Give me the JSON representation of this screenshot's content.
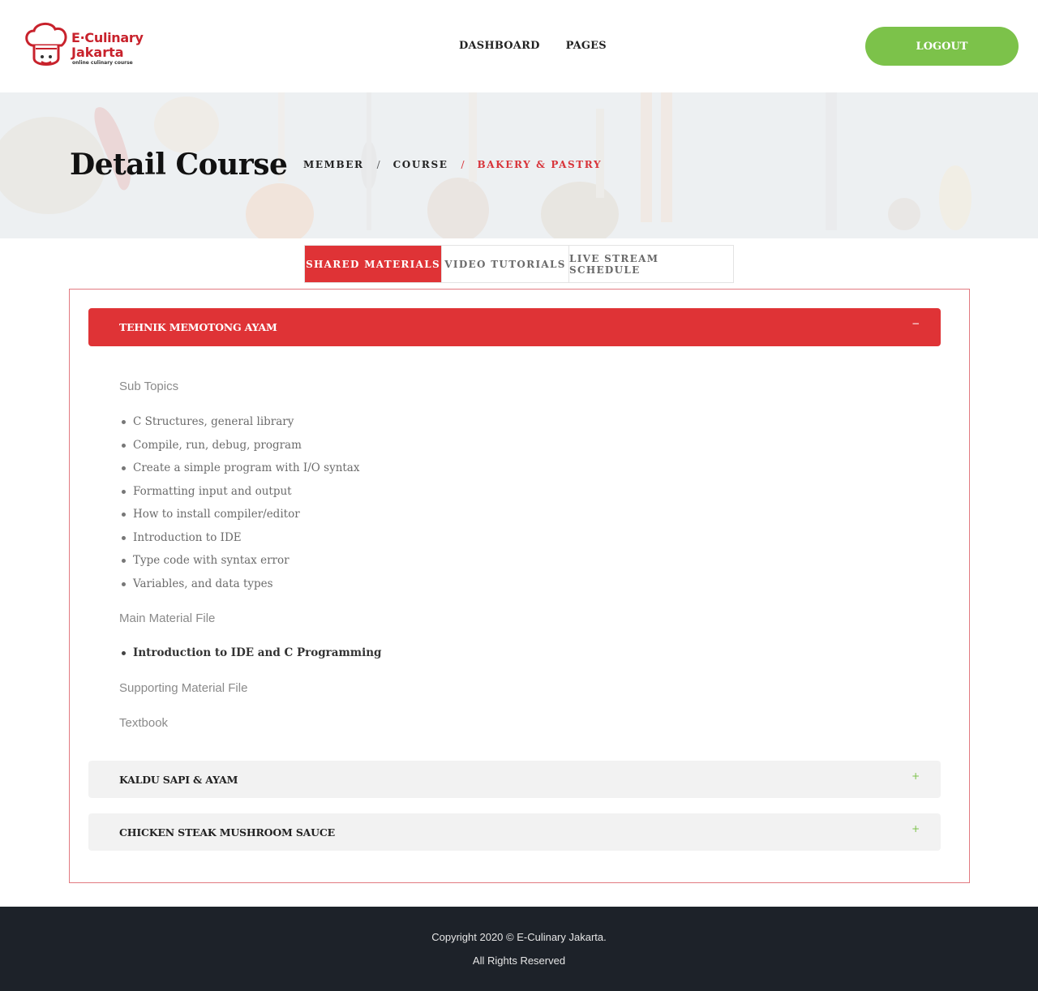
{
  "header": {
    "logo": {
      "line1": "E·Culinary",
      "line2": "Jakarta",
      "tagline": "online culinary course"
    },
    "nav": [
      "DASHBOARD",
      "PAGES"
    ],
    "logout_label": "LOGOUT"
  },
  "hero": {
    "title": "Detail Course",
    "breadcrumb": [
      "MEMBER",
      "COURSE",
      "BAKERY & PASTRY"
    ],
    "separator": "/"
  },
  "tabs": [
    {
      "label": "SHARED MATERIALS",
      "active": true
    },
    {
      "label": "VIDEO TUTORIALS",
      "active": false
    },
    {
      "label": "LIVE STREAM SCHEDULE",
      "active": false
    }
  ],
  "accordion": {
    "open": {
      "title": "TEHNIK MEMOTONG AYAM",
      "toggle": "−",
      "sub_topics_label": "Sub Topics",
      "sub_topics": [
        "C Structures, general library",
        "Compile, run, debug, program",
        "Create a simple program with I/O syntax",
        "Formatting input and output",
        "How to install compiler/editor",
        "Introduction to IDE",
        "Type code with syntax error",
        "Variables, and data types"
      ],
      "main_material_label": "Main Material File",
      "main_material_files": [
        "Introduction to IDE and C Programming"
      ],
      "supporting_material_label": "Supporting Material File",
      "textbook_label": "Textbook"
    },
    "closed": [
      {
        "title": "KALDU SAPI & AYAM",
        "toggle": "+"
      },
      {
        "title": "CHICKEN STEAK MUSHROOM SAUCE",
        "toggle": "+"
      }
    ]
  },
  "footer": {
    "copyright": "Copyright 2020 © E-Culinary Jakarta.",
    "rights": "All Rights Reserved"
  },
  "colors": {
    "accent_red": "#df3336",
    "logout_green": "#7cc24a",
    "footer_bg": "#1d2229"
  }
}
